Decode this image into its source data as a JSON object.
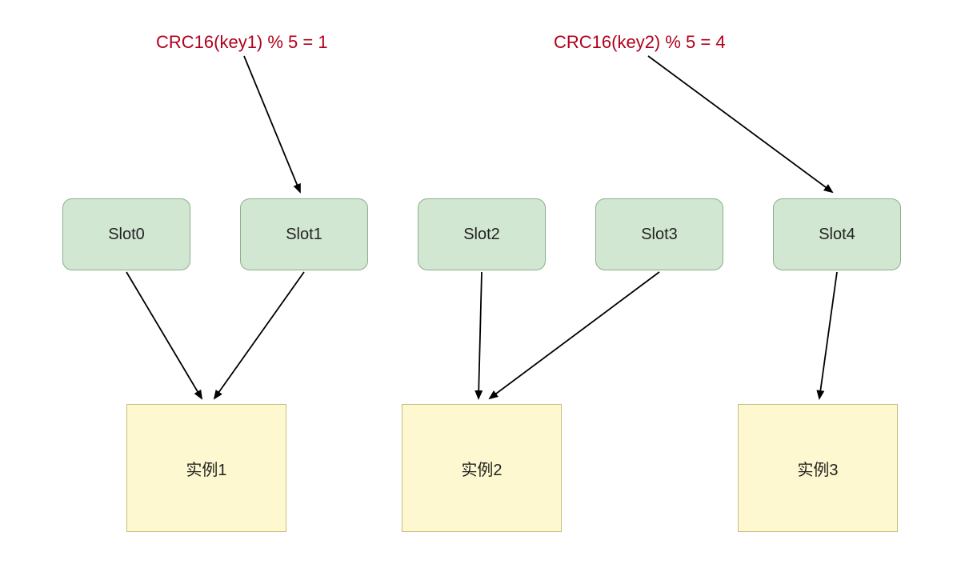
{
  "formulas": {
    "left": "CRC16(key1) % 5 = 1",
    "right": "CRC16(key2) % 5 = 4"
  },
  "slots": [
    {
      "label": "Slot0"
    },
    {
      "label": "Slot1"
    },
    {
      "label": "Slot2"
    },
    {
      "label": "Slot3"
    },
    {
      "label": "Slot4"
    }
  ],
  "instances": [
    {
      "label": "实例1"
    },
    {
      "label": "实例2"
    },
    {
      "label": "实例3"
    }
  ],
  "colors": {
    "formula_text": "#b1001c",
    "slot_fill": "#d2e7d2",
    "slot_border": "#8aae8a",
    "instance_fill": "#fdf8cf",
    "instance_border": "#c7be7b",
    "arrow": "#000000"
  },
  "mapping": {
    "key_to_slot": [
      {
        "formula": "left",
        "slot_index": 1
      },
      {
        "formula": "right",
        "slot_index": 4
      }
    ],
    "slot_to_instance": [
      {
        "slot_index": 0,
        "instance_index": 0
      },
      {
        "slot_index": 1,
        "instance_index": 0
      },
      {
        "slot_index": 2,
        "instance_index": 1
      },
      {
        "slot_index": 3,
        "instance_index": 1
      },
      {
        "slot_index": 4,
        "instance_index": 2
      }
    ]
  }
}
